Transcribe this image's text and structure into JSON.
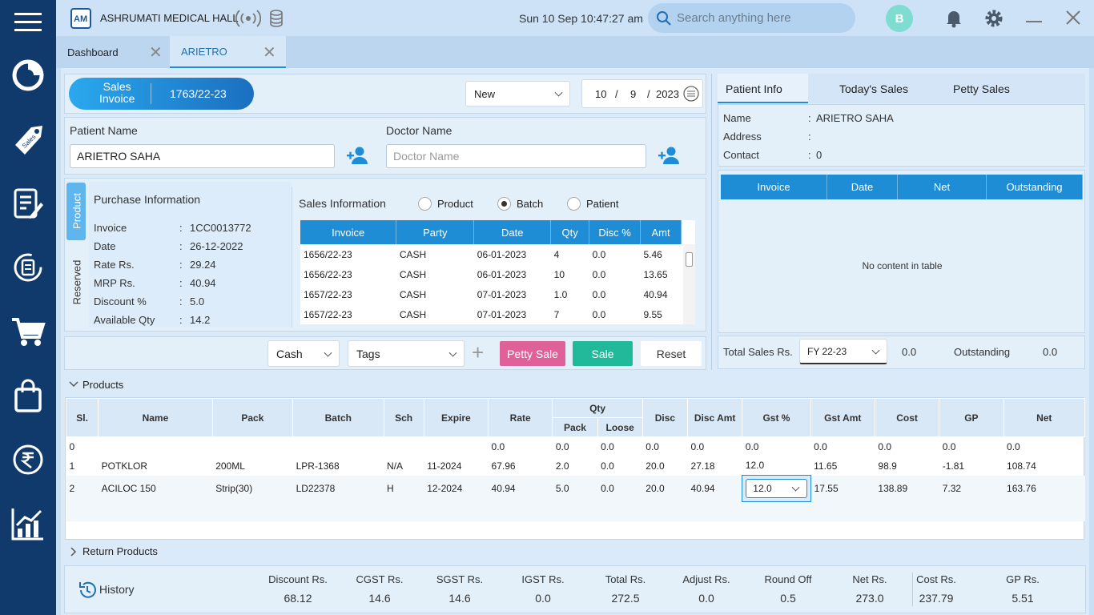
{
  "app": {
    "title": "ASHRUMATI MEDICAL HALL",
    "datetime": "Sun  10 Sep 10:47:27 am",
    "search_placeholder": "Search anything here",
    "avatar_letter": "B"
  },
  "nav_icons": [
    "menu-icon",
    "dashboard-pie-icon",
    "sales-tag-icon",
    "prescription-icon",
    "returns-icon",
    "cart-icon",
    "purchase-bag-icon",
    "rupee-icon",
    "reports-chart-icon"
  ],
  "tabs": [
    {
      "label": "Dashboard"
    },
    {
      "label": "ARIETRO"
    }
  ],
  "invoice": {
    "type_label_1": "Sales",
    "type_label_2": "Invoice",
    "number": "1763/22-23",
    "mode": "New",
    "date_d": "10",
    "date_m": "9",
    "date_y": "2023",
    "sep": "/"
  },
  "patient": {
    "name_label": "Patient Name",
    "name_value": "ARIETRO SAHA",
    "doctor_label": "Doctor Name",
    "doctor_placeholder": "Doctor Name"
  },
  "side_tabs": {
    "product": "Product",
    "reserved": "Reserved"
  },
  "purchase_info": {
    "title": "Purchase Information",
    "rows": [
      {
        "k": "Invoice",
        "v": "1CC0013772"
      },
      {
        "k": "Date",
        "v": "26-12-2022"
      },
      {
        "k": "Rate Rs.",
        "v": "29.24"
      },
      {
        "k": "MRP Rs.",
        "v": "40.94"
      },
      {
        "k": "Discount %",
        "v": "5.0"
      },
      {
        "k": "Available Qty",
        "v": "14.2"
      }
    ]
  },
  "sales_info": {
    "title": "Sales Information",
    "radios": [
      {
        "label": "Product",
        "checked": false
      },
      {
        "label": "Batch",
        "checked": true
      },
      {
        "label": "Patient",
        "checked": false
      }
    ],
    "columns": [
      "Invoice",
      "Party",
      "Date",
      "Qty",
      "Disc %",
      "Amt"
    ],
    "rows": [
      [
        "1656/22-23",
        "CASH",
        "06-01-2023",
        "4",
        "0.0",
        "5.46"
      ],
      [
        "1656/22-23",
        "CASH",
        "06-01-2023",
        "10",
        "0.0",
        "13.65"
      ],
      [
        "1657/22-23",
        "CASH",
        "07-01-2023",
        "1.0",
        "0.0",
        "40.94"
      ],
      [
        "1657/22-23",
        "CASH",
        "07-01-2023",
        "7",
        "0.0",
        "9.55"
      ]
    ]
  },
  "actions": {
    "payment": "Cash",
    "tags": "Tags",
    "plus": "+",
    "petty_sale": "Petty Sale",
    "sale": "Sale",
    "reset": "Reset"
  },
  "right_panel": {
    "tabs": [
      "Patient Info",
      "Today's Sales",
      "Petty Sales"
    ],
    "info": [
      {
        "k": "Name",
        "v": "ARIETRO SAHA"
      },
      {
        "k": "Address",
        "v": ""
      },
      {
        "k": "Contact",
        "v": "0"
      }
    ],
    "colon": ":",
    "columns": [
      "Invoice",
      "Date",
      "Net",
      "Outstanding"
    ],
    "empty": "No content in table",
    "total_label": "Total Sales Rs.",
    "fy": "FY 22-23",
    "total_value": "0.0",
    "outstanding_label": "Outstanding",
    "outstanding_value": "0.0"
  },
  "products": {
    "title": "Products",
    "columns": {
      "sl": "Sl.",
      "name": "Name",
      "pack": "Pack",
      "batch": "Batch",
      "sch": "Sch",
      "expire": "Expire",
      "rate": "Rate",
      "qty": "Qty",
      "qty_pack": "Pack",
      "qty_loose": "Loose",
      "disc": "Disc",
      "disc_amt": "Disc Amt",
      "gst": "Gst %",
      "gst_amt": "Gst Amt",
      "cost": "Cost",
      "gp": "GP",
      "net": "Net"
    },
    "rows": [
      [
        "0",
        "",
        "",
        "",
        "",
        "",
        "0.0",
        "0.0",
        "0.0",
        "0.0",
        "0.0",
        "0.0",
        "0.0",
        "0.0",
        "0.0",
        "0.0"
      ],
      [
        "1",
        "POTKLOR",
        "200ML",
        "LPR-1368",
        "N/A",
        "11-2024",
        "67.96",
        "2.0",
        "0.0",
        "20.0",
        "27.18",
        "12.0",
        "11.65",
        "98.9",
        "-1.81",
        "108.74"
      ],
      [
        "2",
        "ACILOC 150",
        "Strip(30)",
        "LD22378",
        "H",
        "12-2024",
        "40.94",
        "5.0",
        "0.0",
        "20.0",
        "40.94",
        "12.0",
        "17.55",
        "138.89",
        "7.32",
        "163.76"
      ]
    ]
  },
  "return_products": {
    "title": "Return Products"
  },
  "footer": {
    "history": "History",
    "items": [
      {
        "label": "Discount Rs.",
        "value": "68.12"
      },
      {
        "label": "CGST Rs.",
        "value": "14.6"
      },
      {
        "label": "SGST Rs.",
        "value": "14.6"
      },
      {
        "label": "IGST Rs.",
        "value": "0.0"
      },
      {
        "label": "Total Rs.",
        "value": "272.5"
      },
      {
        "label": "Adjust Rs.",
        "value": "0.0"
      },
      {
        "label": "Round Off",
        "value": "0.5"
      },
      {
        "label": "Net Rs.",
        "value": "273.0"
      },
      {
        "label": "Cost Rs.",
        "value": "237.79"
      },
      {
        "label": "GP Rs.",
        "value": "5.51"
      }
    ]
  },
  "colors": {
    "nav": "#0f3a6b",
    "accent": "#1f8dd6",
    "sale_btn": "#20b99a",
    "petty_btn": "#e0609a",
    "avatar": "#7fdcd0"
  }
}
